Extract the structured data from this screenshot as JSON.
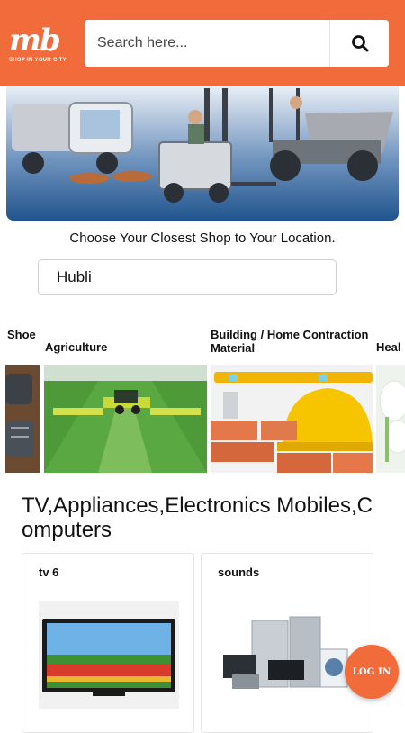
{
  "brand": {
    "logo_text": "mb",
    "tagline": "SHOP IN YOUR CITY",
    "accent": "#f26b3a"
  },
  "search": {
    "placeholder": "Search here...",
    "value": ""
  },
  "location": {
    "prompt": "Choose Your Closest Shop to Your Location.",
    "selected": "Hubli"
  },
  "categories": [
    {
      "label": "Shoe",
      "icon": "shoe-image"
    },
    {
      "label": "Agriculture",
      "icon": "tractor-field-image"
    },
    {
      "label": "Building / Home Contraction Material",
      "icon": "construction-tools-image"
    },
    {
      "label": "Heal",
      "icon": "health-image"
    }
  ],
  "section": {
    "title": "TV,Appliances,Electronics Mobiles,Computers",
    "cards": [
      {
        "title": "tv 6",
        "icon": "tv-image"
      },
      {
        "title": "sounds",
        "icon": "appliances-image"
      }
    ]
  },
  "login_button": {
    "label": "LOG IN"
  }
}
